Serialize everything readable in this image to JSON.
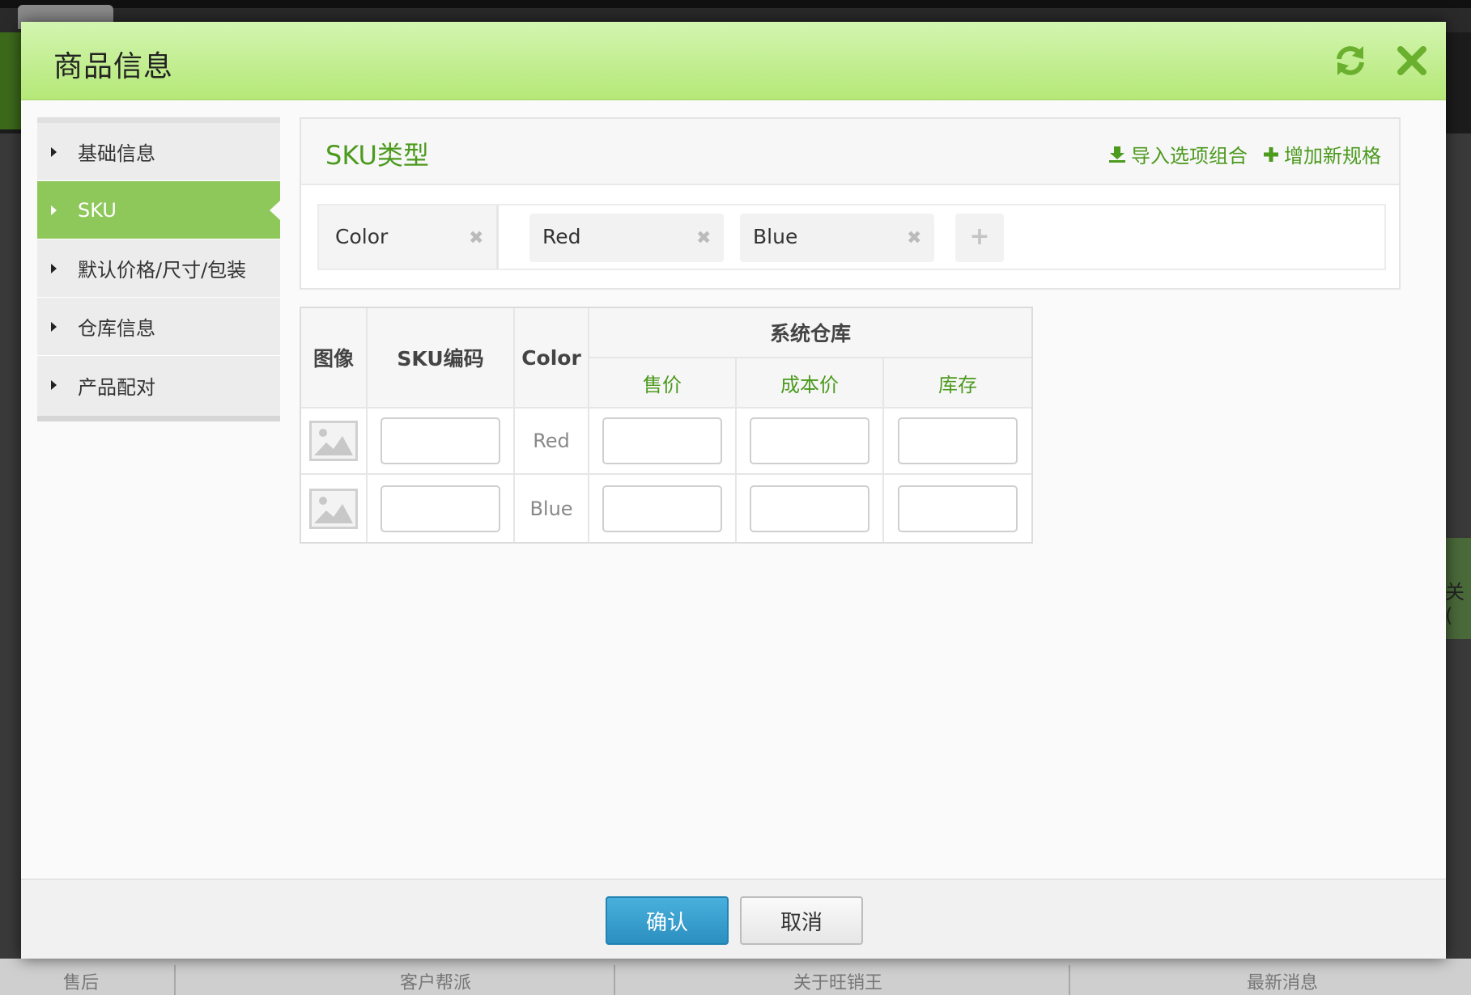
{
  "modal": {
    "title": "商品信息"
  },
  "background": {
    "right_text": "关(",
    "bottom_items": [
      "售后",
      "客户帮派",
      "关于旺销王",
      "最新消息"
    ]
  },
  "sidebar": {
    "items": [
      {
        "label": "基础信息",
        "active": false
      },
      {
        "label": "SKU",
        "active": true
      },
      {
        "label": "默认价格/尺寸/包装",
        "active": false
      },
      {
        "label": "仓库信息",
        "active": false
      },
      {
        "label": "产品配对",
        "active": false
      }
    ]
  },
  "sku_panel": {
    "title": "SKU类型",
    "import_label": "导入选项组合",
    "add_label": "增加新规格",
    "spec": {
      "name": "Color",
      "options": [
        "Red",
        "Blue"
      ]
    }
  },
  "table": {
    "headers": {
      "image": "图像",
      "sku_code": "SKU编码",
      "color": "Color",
      "warehouse": "系统仓库",
      "price": "售价",
      "cost": "成本价",
      "stock": "库存"
    },
    "rows": [
      {
        "color": "Red",
        "sku_code": "",
        "price": "",
        "cost": "",
        "stock": ""
      },
      {
        "color": "Blue",
        "sku_code": "",
        "price": "",
        "cost": "",
        "stock": ""
      }
    ]
  },
  "footer": {
    "ok_label": "确认",
    "cancel_label": "取消"
  },
  "colors": {
    "accent_green": "#4c9a1e",
    "sidebar_active": "#8ec85a",
    "primary_button": "#2b8fc0"
  }
}
